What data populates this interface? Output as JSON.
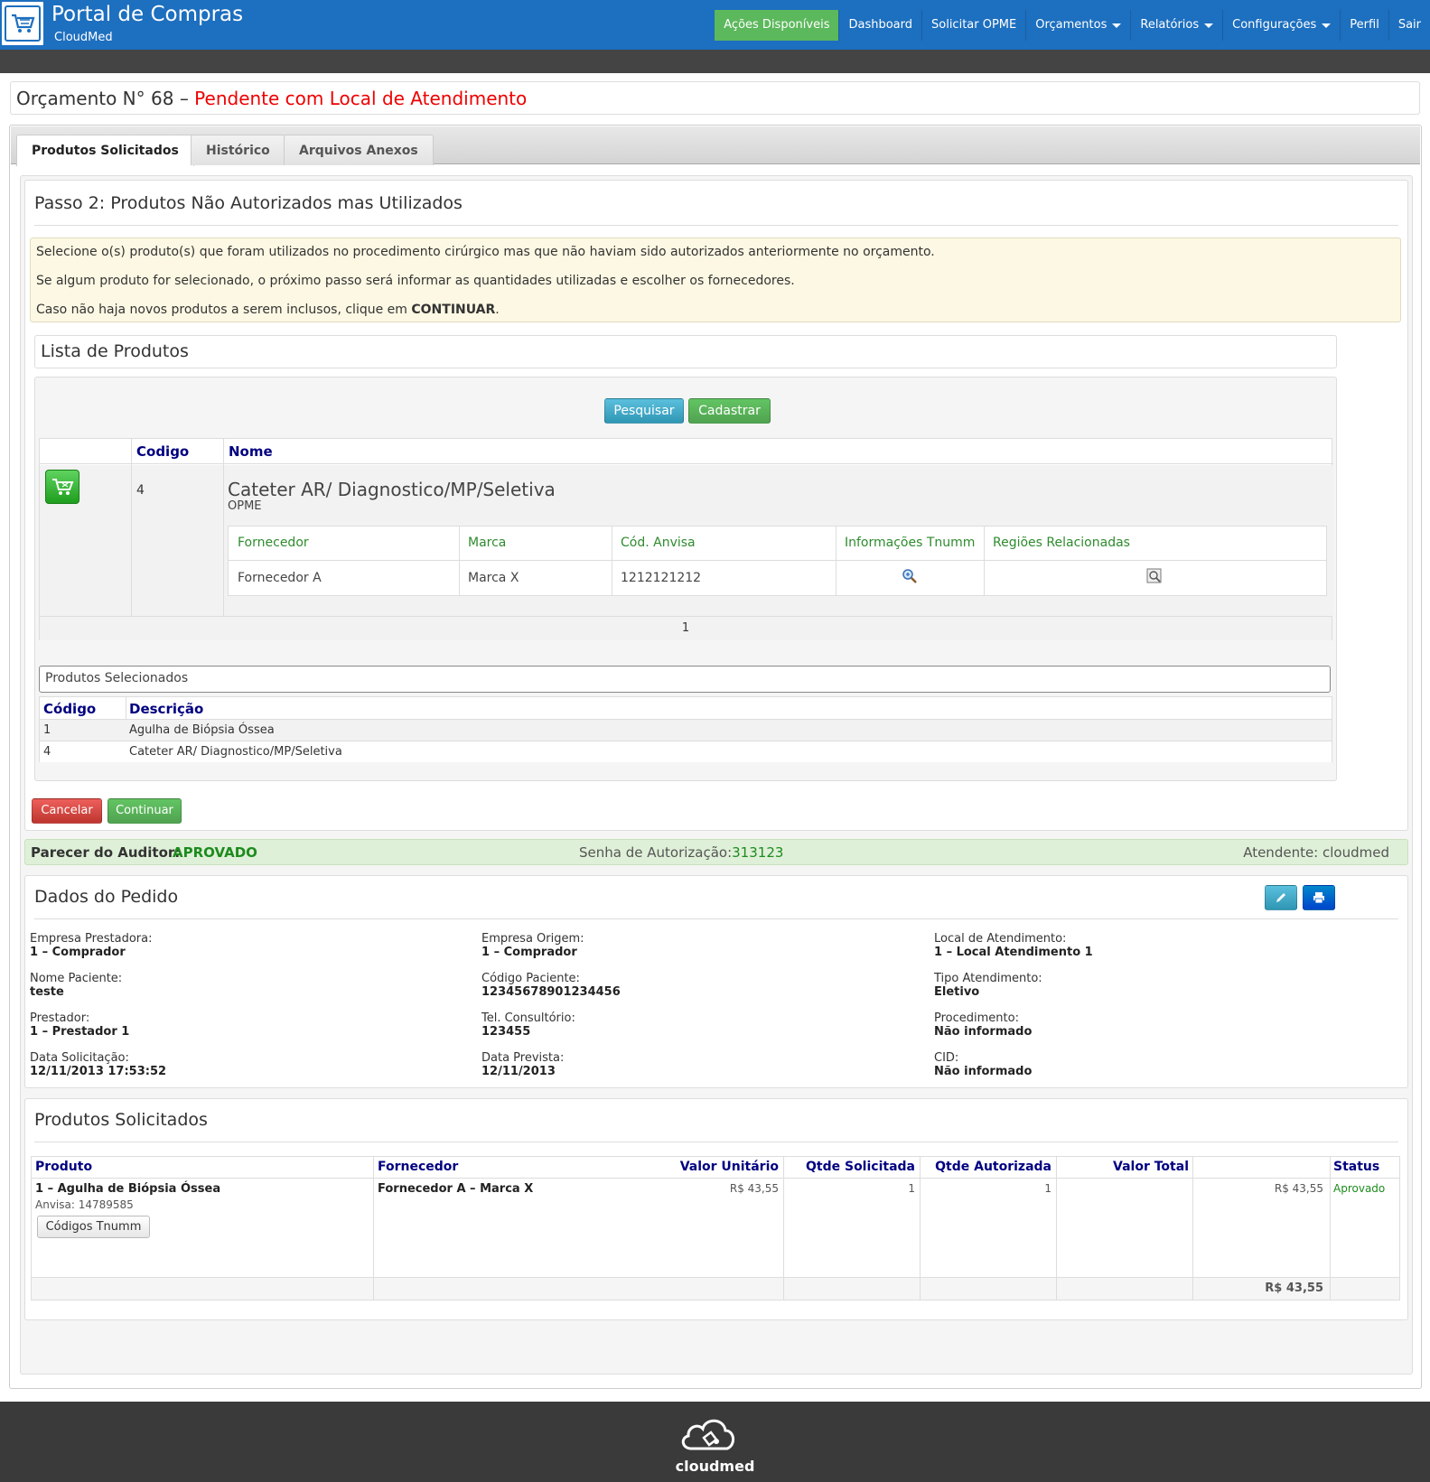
{
  "header": {
    "title": "Portal de Compras",
    "subtitle": "CloudMed",
    "nav": [
      {
        "label": "Ações Disponíveis",
        "active": true,
        "dropdown": false
      },
      {
        "label": "Dashboard",
        "active": false,
        "dropdown": false
      },
      {
        "label": "Solicitar OPME",
        "active": false,
        "dropdown": false
      },
      {
        "label": "Orçamentos",
        "active": false,
        "dropdown": true
      },
      {
        "label": "Relatórios",
        "active": false,
        "dropdown": true
      },
      {
        "label": "Configurações",
        "active": false,
        "dropdown": true
      },
      {
        "label": "Perfil",
        "active": false,
        "dropdown": false
      },
      {
        "label": "Sair",
        "active": false,
        "dropdown": false
      }
    ]
  },
  "page": {
    "title_prefix": "Orçamento N°",
    "number": "68",
    "separator": "–",
    "status": "Pendente com Local de Atendimento"
  },
  "tabs": [
    "Produtos Solicitados",
    "Histórico",
    "Arquivos Anexos"
  ],
  "step": {
    "title": "Passo 2: Produtos Não Autorizados mas Utilizados",
    "alert_line1": "Selecione o(s) produto(s) que foram utilizados no procedimento cirúrgico mas que não haviam sido autorizados anteriormente no orçamento.",
    "alert_line2": "Se algum produto for selecionado, o próximo passo será informar as quantidades utilizadas e escolher os fornecedores.",
    "alert_line3_prefix": "Caso não haja novos produtos a serem inclusos, clique em",
    "alert_line3_bold": "CONTINUAR",
    "alert_line3_suffix": "."
  },
  "product_list": {
    "title": "Lista de Produtos",
    "search_button": "Pesquisar",
    "register_button": "Cadastrar",
    "col_code": "Codigo",
    "col_name": "Nome",
    "item": {
      "code": "4",
      "name": "Cateter AR/ Diagnostico/MP/Seletiva",
      "category": "OPME",
      "sub_headers": [
        "Fornecedor",
        "Marca",
        "Cód. Anvisa",
        "Informações Tnumm",
        "Regiões Relacionadas"
      ],
      "supplier": "Fornecedor A",
      "brand": "Marca X",
      "anvisa": "1212121212"
    },
    "pager": "1"
  },
  "selected": {
    "title": "Produtos Selecionados",
    "col_code": "Código",
    "col_desc": "Descrição",
    "rows": [
      {
        "code": "1",
        "desc": "Agulha de Biópsia Óssea"
      },
      {
        "code": "4",
        "desc": "Cateter AR/ Diagnostico/MP/Seletiva"
      }
    ]
  },
  "actions": {
    "cancel": "Cancelar",
    "continue": "Continuar"
  },
  "auditor": {
    "label": "Parecer do Auditor:",
    "value": "APROVADO",
    "auth_label": "Senha de Autorização:",
    "auth_value": "313123",
    "attendant": "Atendente: cloudmed"
  },
  "order": {
    "title": "Dados do Pedido",
    "fields": [
      {
        "label": "Empresa Prestadora:",
        "value": "1 – Comprador"
      },
      {
        "label": "Empresa Origem:",
        "value": "1 – Comprador"
      },
      {
        "label": "Local de Atendimento:",
        "value": "1 – Local Atendimento 1"
      },
      {
        "label": "Nome Paciente:",
        "value": "teste"
      },
      {
        "label": "Código Paciente:",
        "value": "12345678901234456"
      },
      {
        "label": "Tipo Atendimento:",
        "value": "Eletivo"
      },
      {
        "label": "Prestador:",
        "value": "1 – Prestador 1"
      },
      {
        "label": "Tel. Consultório:",
        "value": "123455"
      },
      {
        "label": "Procedimento:",
        "value": "Não informado"
      },
      {
        "label": "Data Solicitação:",
        "value": "12/11/2013 17:53:52"
      },
      {
        "label": "Data Prevista:",
        "value": "12/11/2013"
      },
      {
        "label": "CID:",
        "value": "Não informado"
      }
    ]
  },
  "requested": {
    "title": "Produtos Solicitados",
    "headers": [
      "Produto",
      "Fornecedor",
      "Valor Unitário",
      "Qtde Solicitada",
      "Qtde Autorizada",
      "Valor Total",
      "Status"
    ],
    "row": {
      "product": "1 – Agulha de Biópsia Óssea",
      "anvisa": "Anvisa: 14789585",
      "tnumm_button": "Códigos Tnumm",
      "supplier": "Fornecedor A – Marca X",
      "unit": "R$ 43,55",
      "qty_req": "1",
      "qty_auth": "1",
      "total": "R$ 43,55",
      "status": "Aprovado"
    },
    "grand_total": "R$ 43,55"
  },
  "footer": {
    "brand": "cloudmed"
  },
  "colors": {
    "brand": "#1d6fbf",
    "status_red": "#e00000",
    "approved_green": "#1e8b1e"
  }
}
